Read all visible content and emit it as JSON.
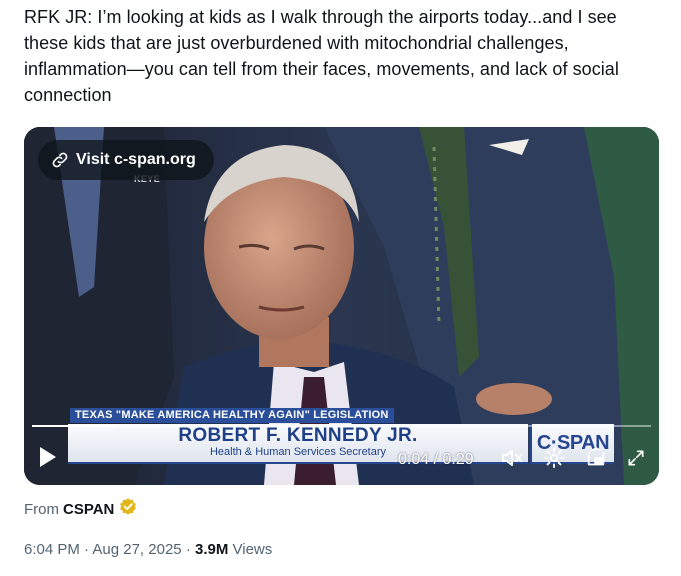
{
  "post": {
    "text": "RFK JR: I’m looking at kids as I walk through the airports today...and I see these kids that are just overburdened with mitochondrial challenges, inflammation—you can tell from their faces, movements, and lack of social connection"
  },
  "video": {
    "visit_link_label": "Visit c-span.org",
    "station_bug": "KEYE",
    "chyron": {
      "banner": "TEXAS \"MAKE AMERICA HEALTHY AGAIN\" LEGISLATION",
      "name": "ROBERT F. KENNEDY JR.",
      "title": "Health & Human Services Secretary",
      "logo": "C·SPAN"
    },
    "player": {
      "time": "0:04 / 0:29",
      "progress": 0.138,
      "icons": {
        "play": "play-icon",
        "mute": "muted-speaker-icon",
        "settings": "gear-icon",
        "pip": "picture-in-picture-icon",
        "fullscreen": "expand-icon",
        "link": "link-icon"
      }
    }
  },
  "source": {
    "prefix": "From",
    "name": "CSPAN",
    "badge_color": "#e2b719"
  },
  "meta": {
    "time": "6:04 PM",
    "separator": "·",
    "date": "Aug 27, 2025",
    "views_count": "3.9M",
    "views_label": "Views"
  }
}
